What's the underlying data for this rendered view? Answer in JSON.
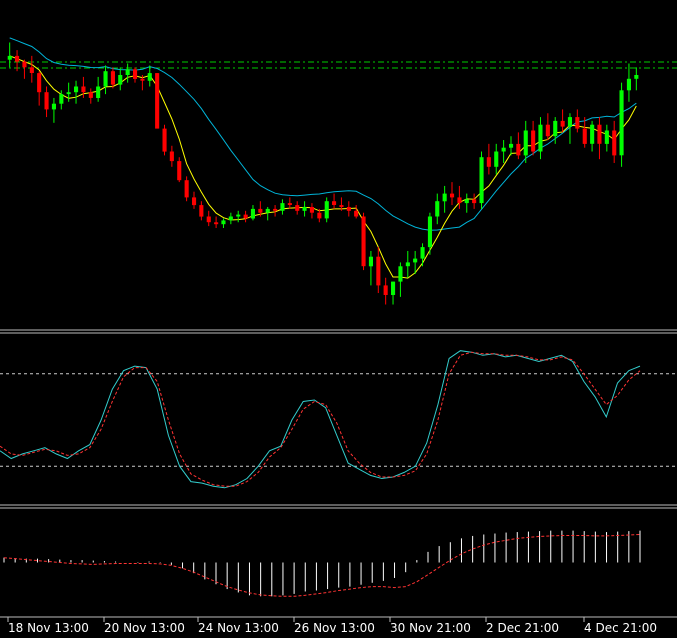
{
  "chart_data": {
    "type": "candlestick",
    "x_ticks": [
      "18 Nov 13:00",
      "20 Nov 13:00",
      "24 Nov 13:00",
      "26 Nov 13:00",
      "30 Nov 21:00",
      "2 Dec 21:00",
      "4 Dec 21:00"
    ],
    "colors": {
      "background": "#000000",
      "bull": "#00ff00",
      "bear": "#ff0000",
      "fast_ma": "#ffff00",
      "slow_ma": "#00b4d8",
      "level": "#00cc00",
      "stoch_main": "#33cccc",
      "stoch_signal": "#ff3333",
      "osc_bar": "#ffffff",
      "osc_signal": "#ff3333",
      "separator": "#bbbbbb",
      "tick_text": "#ffffff"
    },
    "price_panel": {
      "ylim": [
        0,
        100
      ],
      "level_lines": [
        70,
        73
      ],
      "candles": [
        [
          88,
          97,
          84,
          90
        ],
        [
          90,
          93,
          82,
          87
        ],
        [
          87,
          88,
          78,
          84
        ],
        [
          84,
          90,
          76,
          81
        ],
        [
          81,
          82,
          64,
          71
        ],
        [
          71,
          74,
          58,
          62
        ],
        [
          62,
          68,
          55,
          65
        ],
        [
          65,
          72,
          62,
          70
        ],
        [
          70,
          76,
          66,
          71
        ],
        [
          71,
          77,
          65,
          74
        ],
        [
          74,
          79,
          68,
          71
        ],
        [
          71,
          73,
          65,
          68
        ],
        [
          68,
          79,
          66,
          74
        ],
        [
          74,
          85,
          70,
          82
        ],
        [
          82,
          84,
          73,
          75
        ],
        [
          75,
          84,
          72,
          80
        ],
        [
          80,
          86,
          76,
          83
        ],
        [
          83,
          84,
          76,
          78
        ],
        [
          78,
          80,
          72,
          77
        ],
        [
          77,
          85,
          74,
          81
        ],
        [
          81,
          75,
          52,
          52
        ],
        [
          52,
          54,
          38,
          40
        ],
        [
          40,
          43,
          32,
          35
        ],
        [
          35,
          37,
          24,
          25
        ],
        [
          25,
          27,
          14,
          16
        ],
        [
          16,
          19,
          10,
          12
        ],
        [
          12,
          14,
          4,
          6
        ],
        [
          6,
          9,
          1,
          3
        ],
        [
          3,
          6,
          0,
          2
        ],
        [
          2,
          5,
          0,
          4
        ],
        [
          4,
          8,
          2,
          6
        ],
        [
          6,
          9,
          3,
          7
        ],
        [
          7,
          9,
          3,
          5
        ],
        [
          5,
          12,
          4,
          10
        ],
        [
          10,
          14,
          6,
          8
        ],
        [
          8,
          11,
          4,
          10
        ],
        [
          10,
          12,
          6,
          9
        ],
        [
          9,
          15,
          7,
          13
        ],
        [
          13,
          16,
          10,
          12
        ],
        [
          12,
          14,
          7,
          9
        ],
        [
          9,
          14,
          6,
          11
        ],
        [
          11,
          13,
          5,
          8
        ],
        [
          8,
          10,
          3,
          5
        ],
        [
          5,
          16,
          3,
          14
        ],
        [
          14,
          18,
          10,
          12
        ],
        [
          12,
          16,
          9,
          11
        ],
        [
          11,
          14,
          6,
          9
        ],
        [
          9,
          12,
          5,
          6
        ],
        [
          6,
          8,
          -22,
          -20
        ],
        [
          -20,
          -12,
          -30,
          -15
        ],
        [
          -15,
          -10,
          -34,
          -30
        ],
        [
          -30,
          -26,
          -40,
          -35
        ],
        [
          -35,
          -28,
          -40,
          -28
        ],
        [
          -28,
          -18,
          -36,
          -20
        ],
        [
          -20,
          -12,
          -26,
          -18
        ],
        [
          -18,
          -12,
          -24,
          -16
        ],
        [
          -16,
          -8,
          -20,
          -10
        ],
        [
          -10,
          8,
          -14,
          6
        ],
        [
          6,
          18,
          2,
          14
        ],
        [
          14,
          22,
          8,
          18
        ],
        [
          18,
          24,
          12,
          16
        ],
        [
          16,
          22,
          10,
          13
        ],
        [
          13,
          18,
          8,
          15
        ],
        [
          15,
          18,
          10,
          13
        ],
        [
          13,
          40,
          10,
          37
        ],
        [
          37,
          44,
          28,
          32
        ],
        [
          32,
          44,
          28,
          40
        ],
        [
          40,
          46,
          34,
          42
        ],
        [
          42,
          48,
          38,
          44
        ],
        [
          44,
          50,
          36,
          38
        ],
        [
          38,
          56,
          34,
          51
        ],
        [
          51,
          56,
          38,
          40
        ],
        [
          40,
          58,
          36,
          54
        ],
        [
          54,
          60,
          46,
          48
        ],
        [
          48,
          58,
          44,
          56
        ],
        [
          56,
          62,
          50,
          53
        ],
        [
          53,
          60,
          44,
          58
        ],
        [
          58,
          62,
          50,
          52
        ],
        [
          52,
          58,
          42,
          44
        ],
        [
          44,
          56,
          40,
          54
        ],
        [
          54,
          58,
          36,
          44
        ],
        [
          44,
          54,
          40,
          51
        ],
        [
          51,
          56,
          34,
          38
        ],
        [
          38,
          76,
          32,
          72
        ],
        [
          72,
          86,
          66,
          78
        ],
        [
          78,
          84,
          72,
          80
        ]
      ]
    },
    "stochastic_panel": {
      "ylim": [
        0,
        100
      ],
      "levels": [
        80,
        20
      ],
      "main": [
        30,
        25,
        28,
        30,
        32,
        28,
        25,
        30,
        34,
        50,
        70,
        82,
        85,
        84,
        70,
        40,
        20,
        10,
        9,
        7,
        6,
        8,
        12,
        20,
        30,
        33,
        50,
        62,
        63,
        58,
        40,
        22,
        18,
        14,
        12,
        13,
        16,
        20,
        35,
        60,
        90,
        95,
        94,
        92,
        93,
        91,
        92,
        90,
        88,
        90,
        92,
        88,
        75,
        65,
        52,
        74,
        82,
        85
      ],
      "signal": [
        33,
        28,
        27,
        29,
        31,
        30,
        27,
        28,
        32,
        44,
        62,
        78,
        84,
        84,
        75,
        50,
        28,
        15,
        11,
        8,
        7,
        7,
        10,
        16,
        26,
        32,
        44,
        57,
        62,
        60,
        48,
        30,
        22,
        16,
        13,
        13,
        14,
        17,
        28,
        50,
        80,
        92,
        94,
        93,
        93,
        92,
        92,
        91,
        89,
        89,
        91,
        89,
        80,
        70,
        60,
        66,
        76,
        82
      ]
    },
    "oscillator_panel": {
      "ylim": [
        -100,
        100
      ],
      "bars": [
        10,
        9,
        8,
        8,
        7,
        6,
        5,
        5,
        4,
        3,
        2,
        0,
        1,
        2,
        1,
        -5,
        -12,
        -22,
        -35,
        -45,
        -55,
        -62,
        -68,
        -70,
        -70,
        -68,
        -65,
        -60,
        -58,
        -55,
        -52,
        -50,
        -46,
        -42,
        -38,
        -32,
        -20,
        5,
        22,
        34,
        42,
        50,
        55,
        58,
        60,
        62,
        63,
        64,
        65,
        66,
        66,
        66,
        65,
        64,
        63,
        64,
        65,
        66
      ],
      "signal": [
        10,
        8,
        6,
        4,
        2,
        0,
        -2,
        -3,
        -4,
        -3,
        -2,
        -2,
        -2,
        -2,
        -3,
        -6,
        -12,
        -20,
        -30,
        -40,
        -50,
        -57,
        -63,
        -67,
        -69,
        -70,
        -70,
        -68,
        -65,
        -62,
        -58,
        -55,
        -52,
        -50,
        -50,
        -52,
        -50,
        -40,
        -25,
        -10,
        5,
        18,
        28,
        36,
        42,
        46,
        50,
        52,
        54,
        55,
        56,
        56,
        56,
        55,
        55,
        56,
        57,
        58
      ]
    }
  }
}
